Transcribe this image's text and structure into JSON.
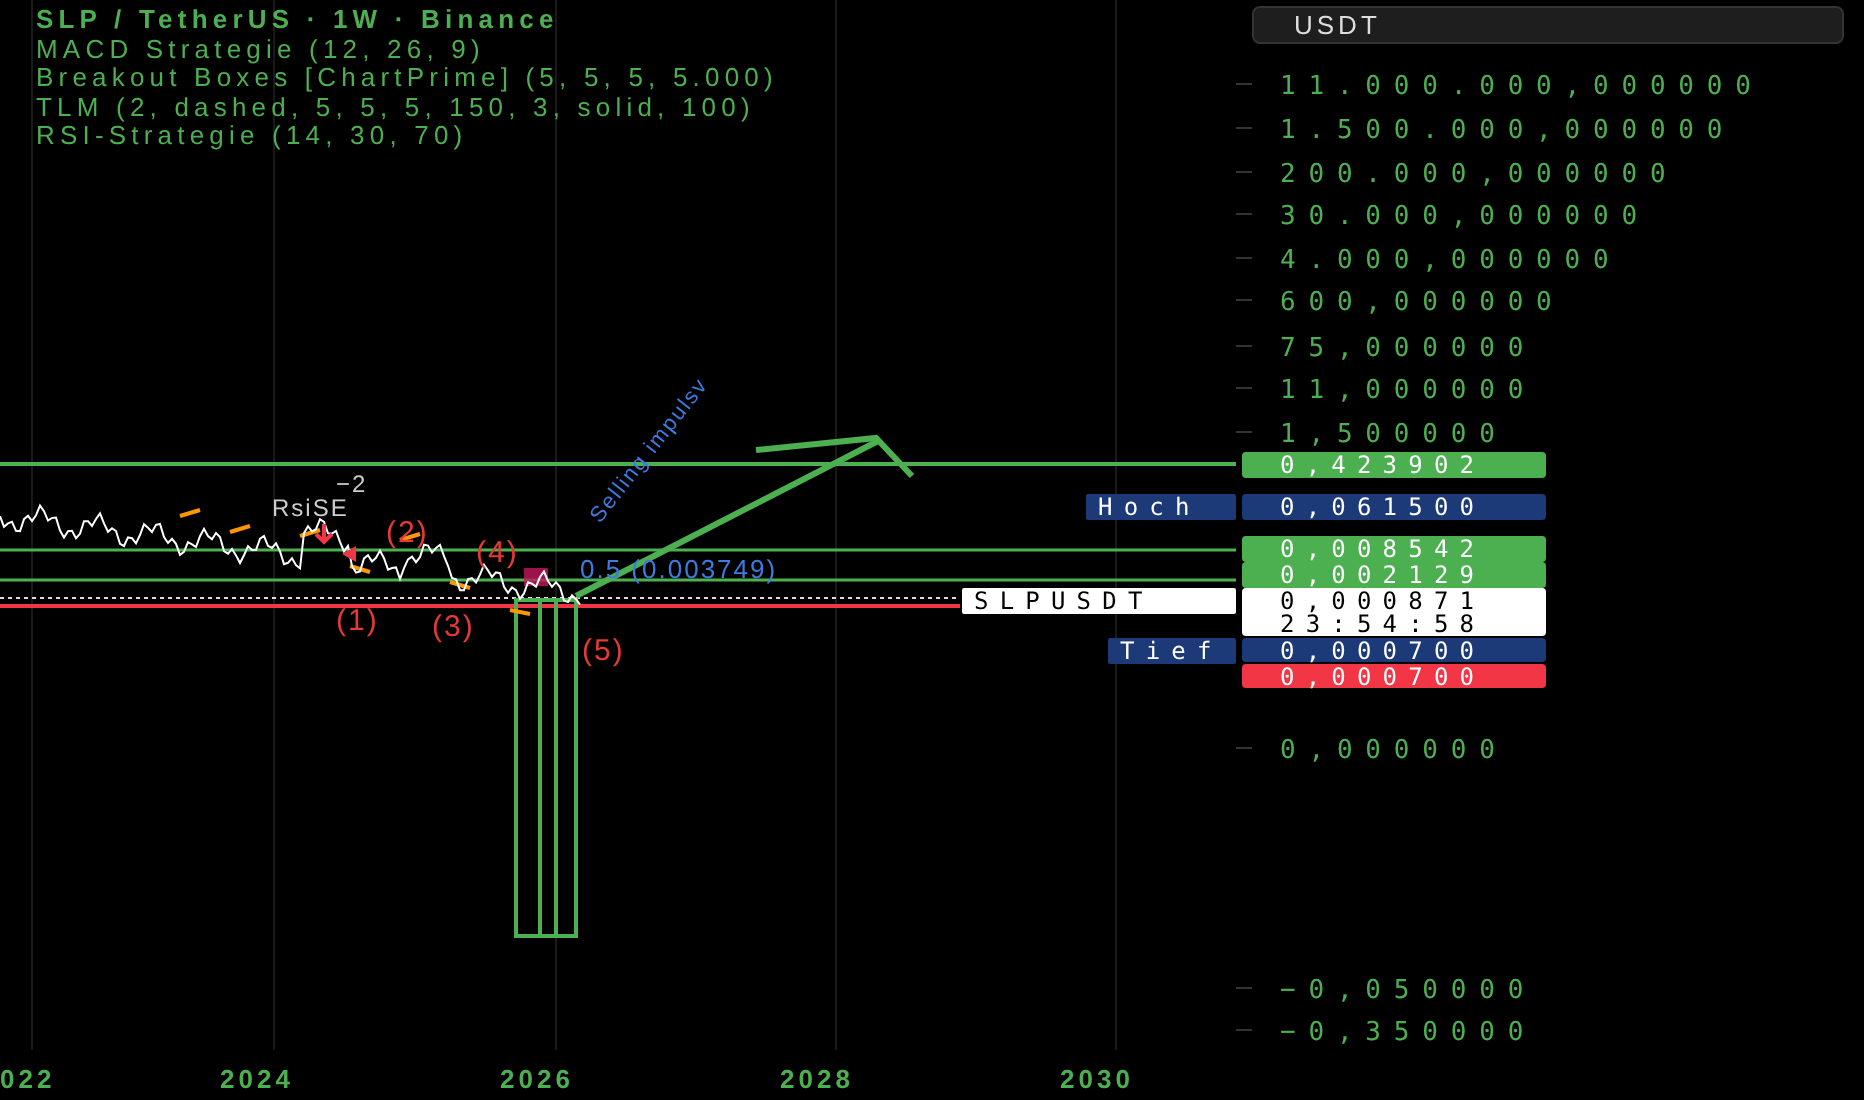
{
  "legend": {
    "title": "SLP / TetherUS · 1W · Binance",
    "indicators": [
      "MACD Strategie (12, 26, 9)",
      "Breakout Boxes [ChartPrime] (5, 5, 5, 5.000)",
      "TLM (2, dashed, 5, 5, 5, 150, 3, solid, 100)",
      "RSI-Strategie (14, 30, 70)"
    ]
  },
  "currency_button": {
    "label": "USDT"
  },
  "price_scale": {
    "ticks": [
      "11.000.000,000000",
      "1.500.000,000000",
      "200.000,000000",
      "30.000,000000",
      "4.000,000000",
      "600,000000",
      "75,000000",
      "11,000000",
      "1,500000",
      "0,000000",
      "−0,050000",
      "−0,350000"
    ]
  },
  "price_tags": [
    {
      "value": "0,423902",
      "kind": "indicator"
    },
    {
      "label": "Hoch",
      "value": "0,061500",
      "kind": "high"
    },
    {
      "value": "0,008542",
      "kind": "indicator"
    },
    {
      "value": "0,002129",
      "kind": "indicator"
    },
    {
      "label": "SLPUSDT",
      "value": "0,000871",
      "countdown": "23:54:58",
      "kind": "last"
    },
    {
      "label": "Tief",
      "value": "0,000700",
      "kind": "low"
    },
    {
      "value": "0,000700",
      "kind": "alert"
    }
  ],
  "annotations": [
    {
      "text": "−2"
    },
    {
      "text": "RsiSE"
    },
    {
      "text": "(2)"
    },
    {
      "text": "(4)"
    },
    {
      "text": "(1)"
    },
    {
      "text": "(3)"
    },
    {
      "text": "(5)"
    },
    {
      "text": "0.5 (0.003749)"
    },
    {
      "text": "Selling impulsv"
    }
  ],
  "time_axis": {
    "labels": [
      "022",
      "2024",
      "2026",
      "2028",
      "2030"
    ]
  }
}
